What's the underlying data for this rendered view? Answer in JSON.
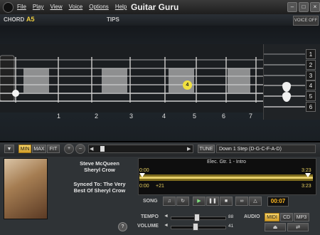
{
  "window": {
    "title": "Guitar Guru",
    "menu": [
      "File",
      "Play",
      "View",
      "Voice",
      "Options",
      "Help"
    ]
  },
  "chordbar": {
    "chord_label": "CHORD",
    "chord_value": "A5",
    "tips_label": "TIPS",
    "voice_button": "VOICE OFF"
  },
  "fretboard": {
    "fret_numbers": [
      "1",
      "2",
      "3",
      "4",
      "5",
      "6",
      "7"
    ],
    "string_numbers": [
      "1",
      "2",
      "3",
      "4",
      "5",
      "6"
    ],
    "finger_marker": "4"
  },
  "controls": {
    "min": "MIN",
    "max": "MAX",
    "fit": "FIT",
    "tune_button": "TUNE",
    "tune_value": "Down 1 Step (D-G-C-F-A-D)"
  },
  "song": {
    "artist_line1": "Steve McQueen",
    "artist_line2": "Sheryl Crow",
    "album_line1": "Synced To: The Very",
    "album_line2": "Best Of Sheryl Crow",
    "track": "Elec. Gtr. 1 - Intro",
    "time_start": "0:00",
    "time_end": "3:23",
    "loop_start": "0:00",
    "offset": "+21",
    "loop_end": "3:23",
    "song_label": "SONG",
    "current_time": "00:07"
  },
  "mix": {
    "tempo_label": "TEMPO",
    "tempo_value": "88",
    "volume_label": "VOLUME",
    "volume_value": "41",
    "audio_label": "AUDIO",
    "midi": "MIDI",
    "cd": "CD",
    "mp3": "MP3"
  },
  "colors": {
    "accent": "#f0d040",
    "time": "#ffb820"
  }
}
